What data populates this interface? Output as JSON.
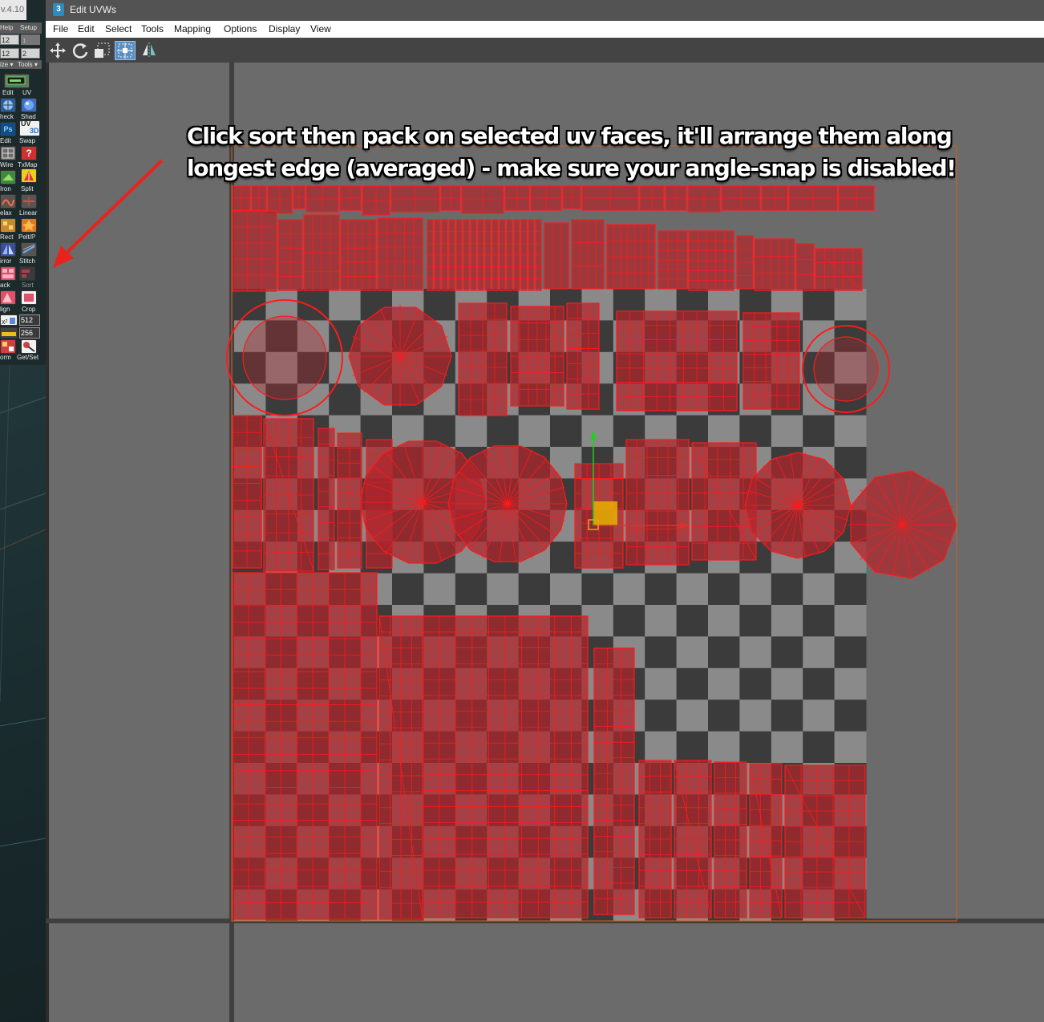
{
  "left_panel": {
    "version": "v.4.10",
    "top_buttons": [
      "Help",
      "Setup"
    ],
    "spinner_rows": [
      [
        "12",
        "↕"
      ],
      [
        "12",
        "2"
      ]
    ],
    "dropdowns": [
      "ize ▾",
      "Tools ▾"
    ],
    "tool_labels": [
      [
        "Edit",
        "UV"
      ],
      [
        "heck",
        "Shad"
      ],
      [
        "Edit",
        "Swap"
      ],
      [
        "Wire",
        "TxMap"
      ],
      [
        "Iron",
        "Split"
      ],
      [
        "elax",
        "Linear"
      ],
      [
        "Rect",
        "Pelt/P"
      ],
      [
        "irror",
        "Stitch"
      ],
      [
        "ack",
        "Sort"
      ],
      [
        "lign",
        "Crop"
      ],
      [
        "orm",
        "Get/Set"
      ]
    ],
    "size_values": [
      "512",
      "256"
    ],
    "icon_badge_text": [
      "Ps",
      "UV",
      "3D"
    ]
  },
  "window": {
    "title": "Edit UVWs",
    "app_icon_glyph": "3",
    "menu": [
      "File",
      "Edit",
      "Select",
      "Tools",
      "Mapping",
      "Options",
      "Display",
      "View"
    ],
    "toolbar_icons": [
      "move-icon",
      "rotate-icon",
      "scale-icon",
      "freeform-icon",
      "mirror-icon"
    ]
  },
  "annotation": {
    "text": "Click sort then pack on selected uv faces, it'll arrange them along longest edge (averaged) - make sure your angle-snap is disabled!"
  },
  "colors": {
    "viewport_bg": "#6b6b6b",
    "checker_dark": "#3b3b3b",
    "checker_light": "#8a8a8a",
    "uv_fill": "#b0242b",
    "uv_edge": "#ff1a1a",
    "selection_box": "#d06020",
    "gizmo_y": "#20d020",
    "gizmo_x": "#e03030",
    "gizmo_center": "#e8b000",
    "arrow": "#e8231e"
  }
}
